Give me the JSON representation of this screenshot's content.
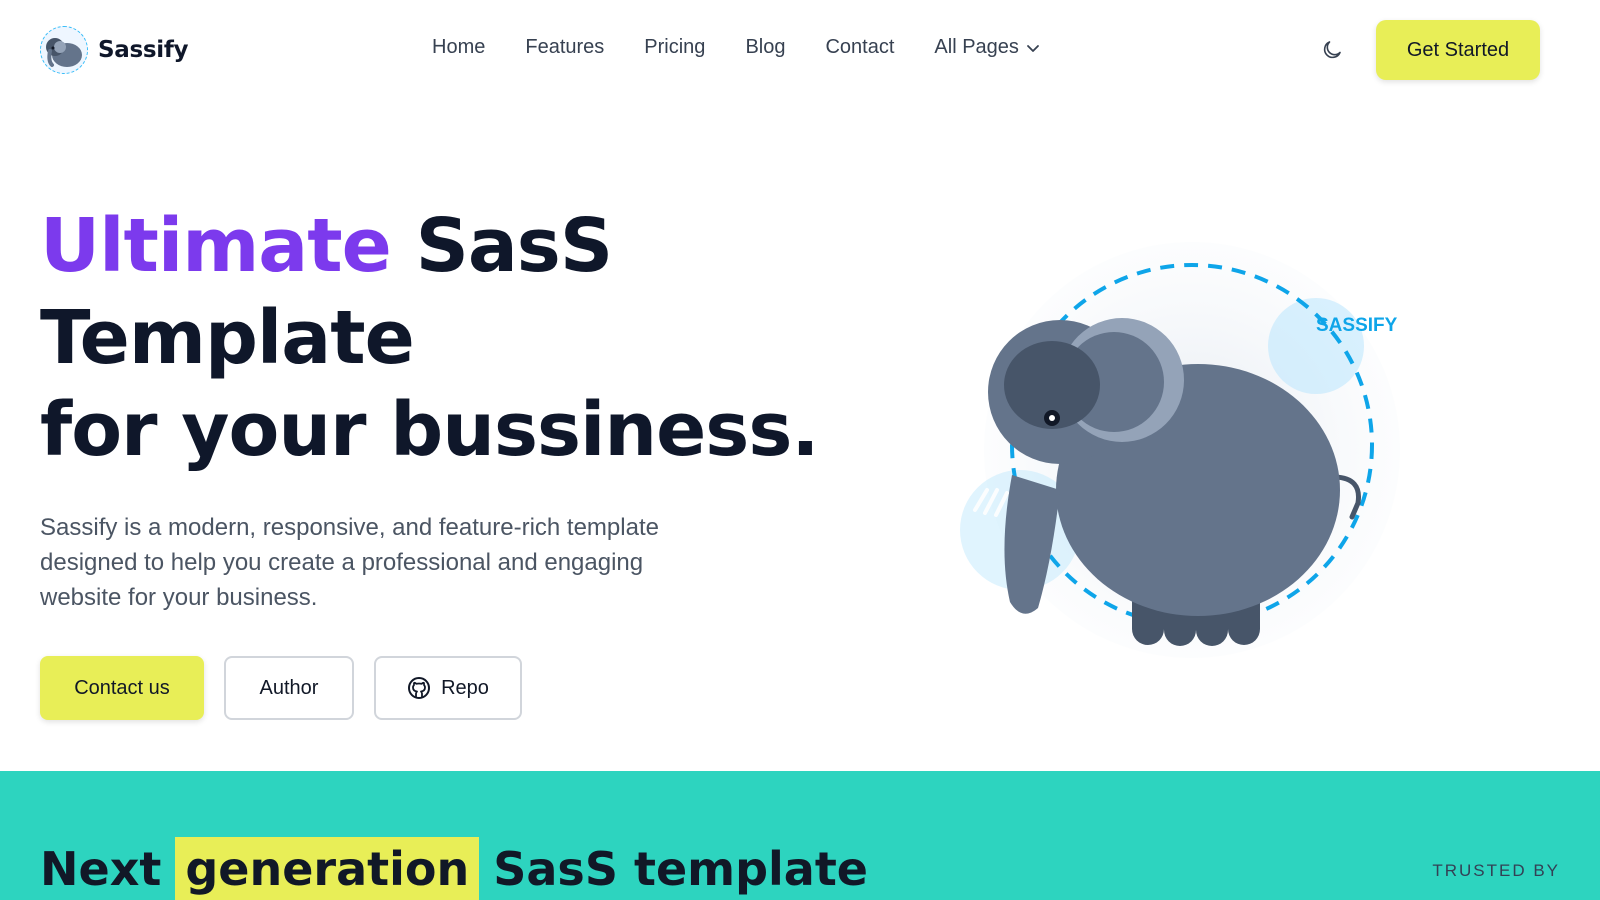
{
  "brand": {
    "name": "Sassify"
  },
  "nav": {
    "items": [
      {
        "label": "Home"
      },
      {
        "label": "Features"
      },
      {
        "label": "Pricing"
      },
      {
        "label": "Blog"
      },
      {
        "label": "Contact"
      },
      {
        "label": "All Pages"
      }
    ],
    "theme_icon": "moon-icon",
    "cta_label": "Get Started"
  },
  "hero": {
    "title_accent": "Ultimate",
    "title_rest": "SasS",
    "title_line2": "Template",
    "title_line3": "for your bussiness.",
    "description": "Sassify is a modern, responsive, and feature-rich template designed to help you create a professional and engaging website for your business.",
    "buttons": {
      "contact": "Contact us",
      "author": "Author",
      "repo": "Repo"
    },
    "illustration_text": "SASSIFY"
  },
  "band": {
    "title_pre": "Next",
    "title_highlight": "generation",
    "title_post": "SasS template",
    "trusted_label": "TRUSTED BY"
  },
  "colors": {
    "accent": "#7c3aed",
    "cta": "#e8ee57",
    "band": "#2dd4bf",
    "ring": "#0ea5e9"
  }
}
